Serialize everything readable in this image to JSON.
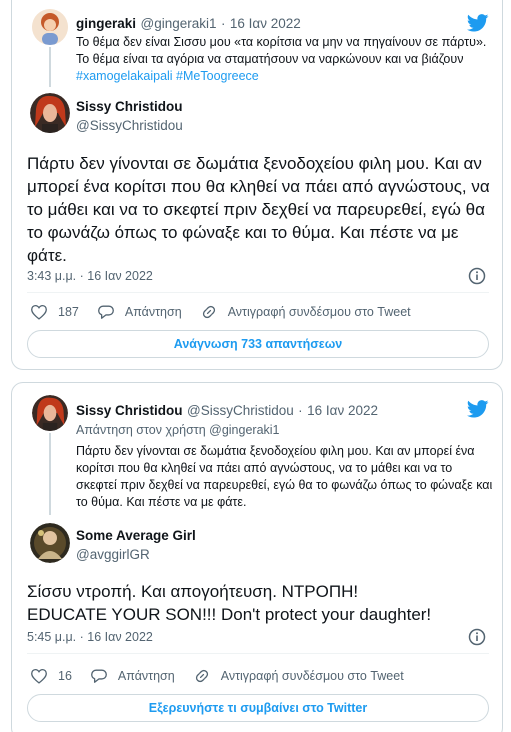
{
  "tweet1": {
    "quoted": {
      "name": "gingeraki",
      "handle": "@gingeraki1",
      "separator": "·",
      "date": "16 Ιαν 2022",
      "text": "Το θέμα δεν είναι Σισσυ μου «τα κορίτσια να μην να πηγαίνουν σε πάρτυ». Το θέμα είναι τα αγόρια να σταματήσουν να ναρκώνουν και να βιάζουν",
      "hashtags": "#xamogelakaipali #MeToogreece"
    },
    "author": {
      "name": "Sissy Christidou",
      "handle": "@SissyChristidou"
    },
    "text": "Πάρτυ δεν γίνονται σε δωμάτια ξενοδοχείου φιλη μου. Και αν μπορεί ένα κορίτσι που θα κληθεί να πάει από αγνώστους, να το μάθει και να το σκεφτεί πριν δεχθεί να παρευρεθεί, εγώ θα το φωνάζω όπως το φώναξε και το θύμα. Και πέστε να με φάτε.",
    "timestamp": "3:43 μ.μ. · 16 Ιαν 2022",
    "likes": "187",
    "reply_label": "Απάντηση",
    "copy_label": "Αντιγραφή συνδέσμου στο Tweet",
    "read_replies": "Ανάγνωση 733 απαντήσεων"
  },
  "tweet2": {
    "quoted": {
      "name": "Sissy Christidou",
      "handle": "@SissyChristidou",
      "separator": "·",
      "date": "16 Ιαν 2022",
      "reply_to": "Απάντηση στον χρήστη @gingeraki1",
      "text": "Πάρτυ δεν γίνονται σε δωμάτια ξενοδοχείου φιλη μου. Και αν μπορεί ένα κορίτσι που θα κληθεί να πάει από αγνώστους, να το μάθει και να το σκεφτεί πριν δεχθεί να παρευρεθεί, εγώ θα το φωνάζω όπως το φώναξε και το θύμα. Και πέστε να με φάτε."
    },
    "author": {
      "name": "Some Average Girl",
      "handle": "@avggirlGR"
    },
    "text_line1": "Σίσσυ ντροπή. Και απογοήτευση. ΝΤΡΟΠΗ!",
    "text_line2": "EDUCATE YOUR SON!!! Don't protect your daughter!",
    "timestamp": "5:45 μ.μ. · 16 Ιαν 2022",
    "likes": "16",
    "reply_label": "Απάντηση",
    "copy_label": "Αντιγραφή συνδέσμου στο Tweet",
    "explore": "Εξερευνήστε τι συμβαίνει στο Twitter"
  },
  "colors": {
    "accent": "#1d9bf0",
    "text": "#0f1419",
    "secondary": "#536471",
    "border": "#cfd9de"
  },
  "icons": [
    "twitter-bird-icon",
    "heart-icon",
    "reply-icon",
    "link-icon",
    "info-icon"
  ]
}
